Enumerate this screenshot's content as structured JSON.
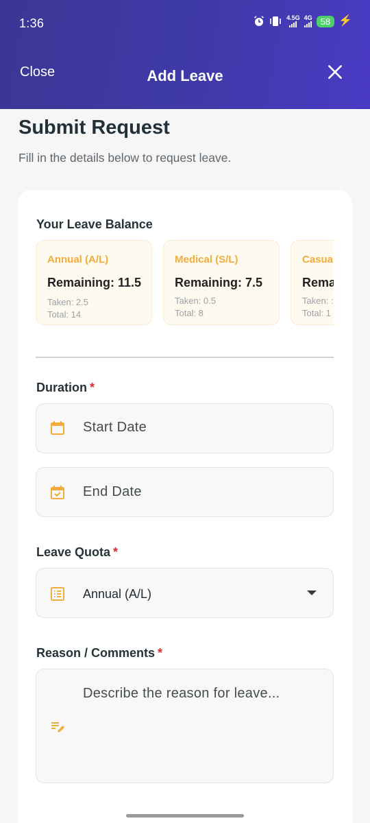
{
  "status": {
    "time": "1:36",
    "net1": "4.5G",
    "net2": "4G",
    "battery": "58"
  },
  "header": {
    "close_label": "Close",
    "title": "Add Leave"
  },
  "page": {
    "title": "Submit Request",
    "subtitle": "Fill in the details below to request leave."
  },
  "balance": {
    "heading": "Your Leave Balance",
    "items": [
      {
        "name": "Annual (A/L)",
        "remaining": "Remaining: 11.5",
        "taken": "Taken: 2.5",
        "total": "Total: 14"
      },
      {
        "name": "Medical (S/L)",
        "remaining": "Remaining: 7.5",
        "taken": "Taken: 0.5",
        "total": "Total: 8"
      },
      {
        "name": "Casua",
        "remaining": "Rema",
        "taken": "Taken: :",
        "total": "Total: 1"
      }
    ]
  },
  "duration": {
    "label": "Duration",
    "required": "*",
    "start_placeholder": "Start Date",
    "end_placeholder": "End Date"
  },
  "quota": {
    "label": "Leave Quota",
    "required": "*",
    "selected": "Annual (A/L)"
  },
  "reason": {
    "label": "Reason / Comments",
    "required": "*",
    "placeholder": "Describe the reason for leave..."
  },
  "colors": {
    "header_start": "#3b3795",
    "header_end": "#4a3bc4",
    "accent": "#f2ac3c",
    "required": "#d32f2f"
  }
}
